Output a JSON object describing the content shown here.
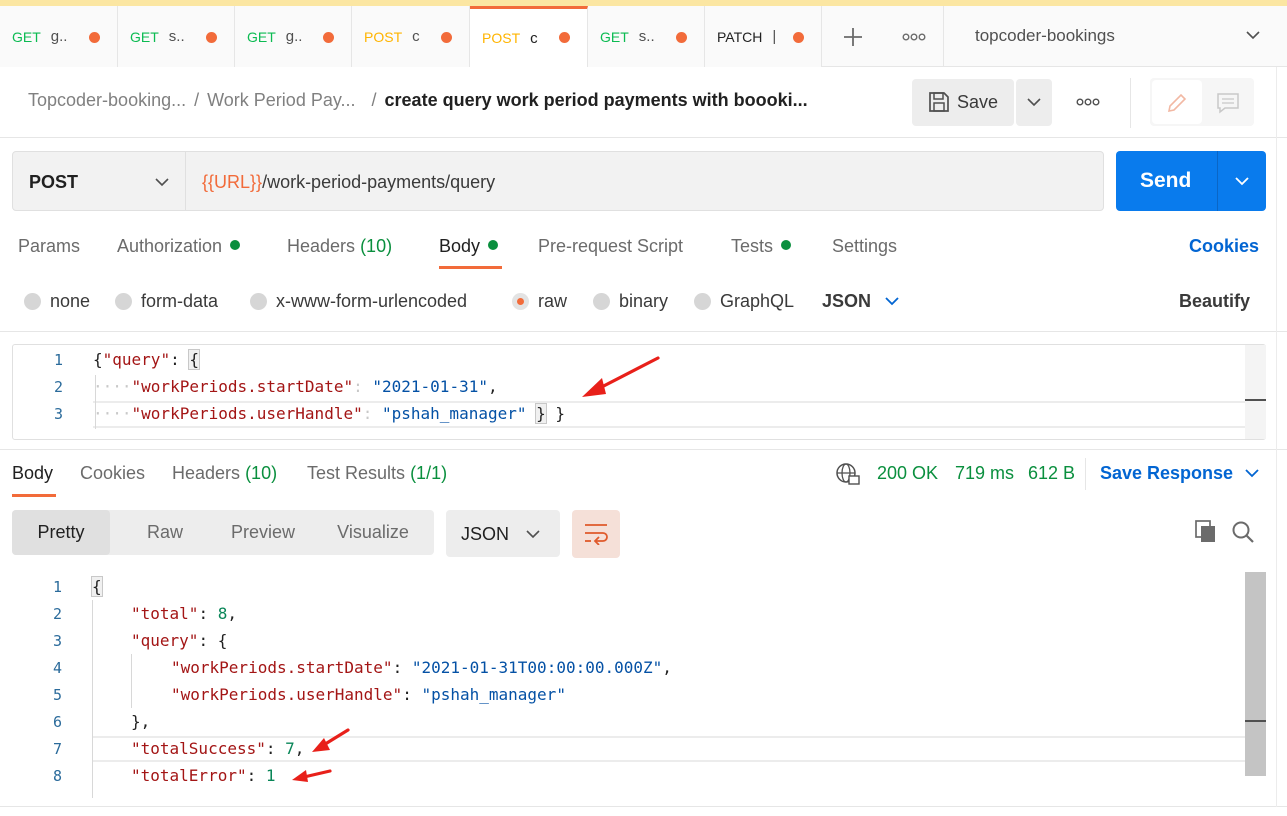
{
  "tabs": [
    {
      "method": "GET",
      "name": "g.."
    },
    {
      "method": "GET",
      "name": "s.."
    },
    {
      "method": "GET",
      "name": "g.."
    },
    {
      "method": "POST",
      "name": "c"
    },
    {
      "method": "POST",
      "name": "c"
    },
    {
      "method": "GET",
      "name": "s.."
    },
    {
      "method": "PATCH",
      "name": "|"
    }
  ],
  "workspace": "topcoder-bookings",
  "breadcrumb": {
    "collection": "Topcoder-booking...",
    "folder": "Work Period Pay...",
    "request": "create query work period payments with boooki..."
  },
  "toolbar": {
    "save_label": "Save"
  },
  "request": {
    "method": "POST",
    "url_var": "{{URL}}",
    "url_path": "/work-period-payments/query",
    "send_label": "Send"
  },
  "request_tabs": {
    "params": "Params",
    "authorization": "Authorization",
    "headers": "Headers",
    "headers_count": "(10)",
    "body": "Body",
    "prerequest": "Pre-request Script",
    "tests": "Tests",
    "settings": "Settings",
    "cookies": "Cookies"
  },
  "body_modes": {
    "none": "none",
    "form_data": "form-data",
    "urlencoded": "x-www-form-urlencoded",
    "raw": "raw",
    "binary": "binary",
    "graphql": "GraphQL",
    "format": "JSON",
    "beautify": "Beautify"
  },
  "request_body": {
    "line_numbers": [
      "1",
      "2",
      "3"
    ],
    "query_key": "\"query\"",
    "k1": "\"workPeriods.startDate\"",
    "v1": "\"2021-01-31\"",
    "k2": "\"workPeriods.userHandle\"",
    "v2": "\"pshah_manager\""
  },
  "response_tabs": {
    "body": "Body",
    "cookies": "Cookies",
    "headers": "Headers",
    "headers_count": "(10)",
    "test_results": "Test Results",
    "test_count": "(1/1)"
  },
  "response_status": {
    "status": "200 OK",
    "time": "719 ms",
    "size": "612 B",
    "save_response": "Save Response"
  },
  "response_view": {
    "pretty": "Pretty",
    "raw": "Raw",
    "preview": "Preview",
    "visualize": "Visualize",
    "format": "JSON"
  },
  "response_body": {
    "line_numbers": [
      "1",
      "2",
      "3",
      "4",
      "5",
      "6",
      "7",
      "8"
    ],
    "total_key": "\"total\"",
    "total_val": "8",
    "query_key": "\"query\"",
    "k1": "\"workPeriods.startDate\"",
    "v1": "\"2021-01-31T00:00:00.000Z\"",
    "k2": "\"workPeriods.userHandle\"",
    "v2": "\"pshah_manager\"",
    "success_key": "\"totalSuccess\"",
    "success_val": "7",
    "error_key": "\"totalError\"",
    "error_val": "1"
  },
  "colors": {
    "accent": "#f26b3a",
    "send": "#097bed",
    "link": "#0265d2",
    "status_ok": "#0a8f3e",
    "annotation_arrow": "#e8201a"
  }
}
